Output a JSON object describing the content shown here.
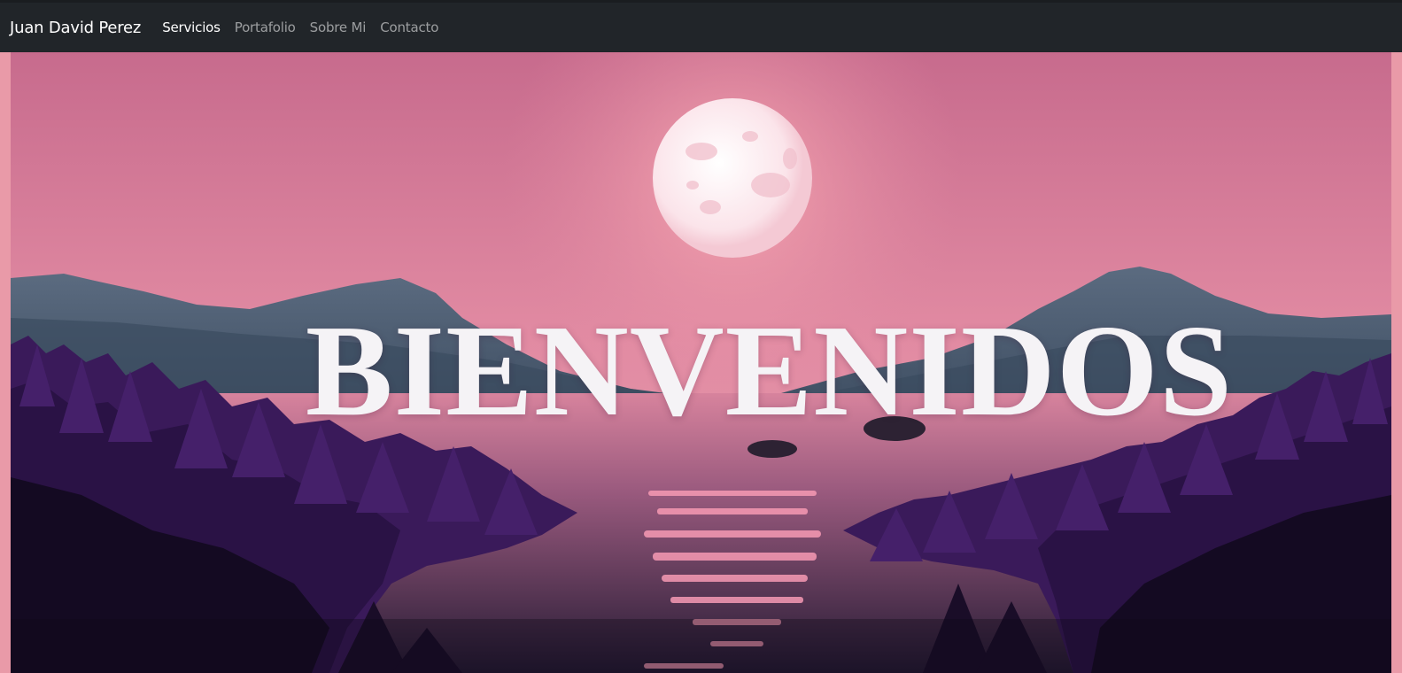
{
  "navbar": {
    "brand": "Juan David Perez",
    "links": [
      {
        "label": "Servicios",
        "active": true
      },
      {
        "label": "Portafolio",
        "active": false
      },
      {
        "label": "Sobre Mi",
        "active": false
      },
      {
        "label": "Contacto",
        "active": false
      }
    ]
  },
  "hero": {
    "title": "BIENVENIDOS",
    "scene": "pink-sunset-moon-lake-mountains-pine-trees"
  },
  "colors": {
    "navbar_bg": "#212529",
    "sky": "#d97b98",
    "moon": "#fbe4ea",
    "frame": "#e99aa8"
  }
}
